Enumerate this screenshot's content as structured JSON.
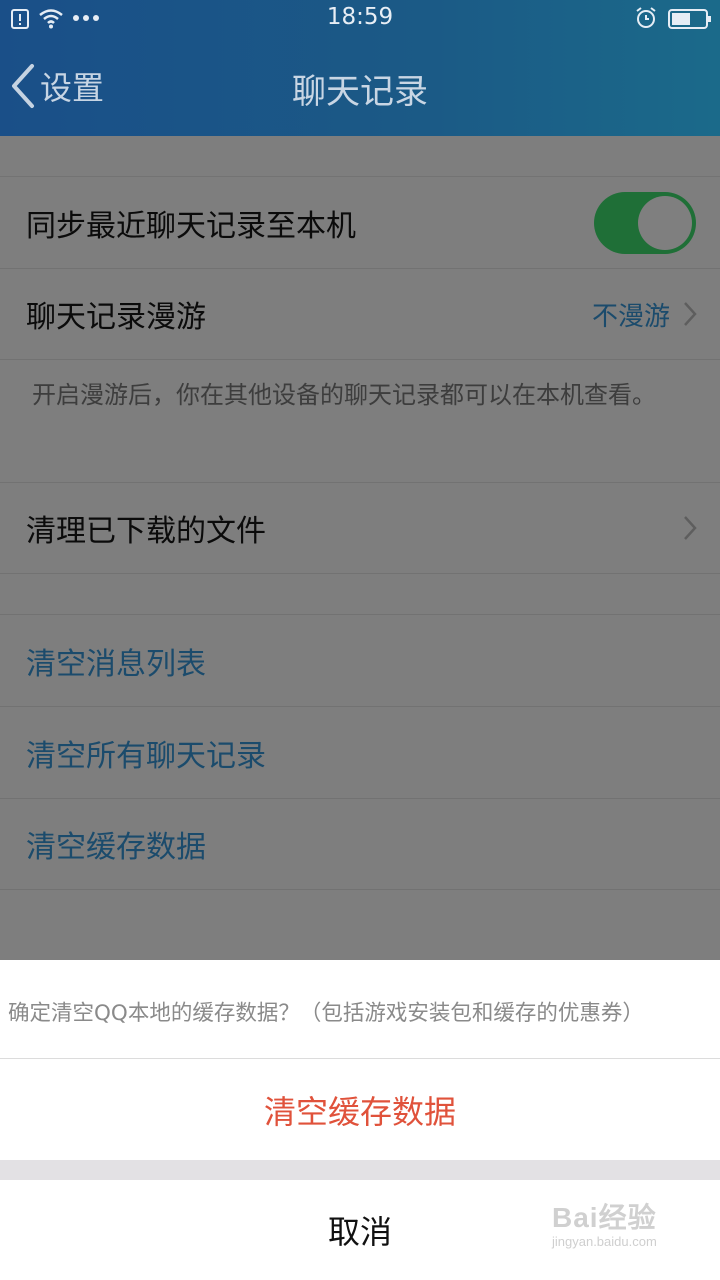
{
  "status_bar": {
    "time": "18:59"
  },
  "nav": {
    "back_label": "设置",
    "title": "聊天记录"
  },
  "settings": {
    "sync": {
      "label": "同步最近聊天记录至本机",
      "enabled": true
    },
    "roaming": {
      "label": "聊天记录漫游",
      "value": "不漫游"
    },
    "roaming_note": "开启漫游后，你在其他设备的聊天记录都可以在本机查看。",
    "clean_downloads": {
      "label": "清理已下载的文件"
    },
    "clear_message_list": "清空消息列表",
    "clear_all_records": "清空所有聊天记录",
    "clear_cache": "清空缓存数据"
  },
  "action_sheet": {
    "message": "确定清空QQ本地的缓存数据？（包括游戏安装包和缓存的优惠券）",
    "confirm": "清空缓存数据",
    "cancel": "取消"
  },
  "watermark": {
    "brand": "Bai经验",
    "url": "jingyan.baidu.com"
  },
  "colors": {
    "header": "#1b5a86",
    "toggle_on": "#1f6f37",
    "link": "#1b4b6c",
    "destructive": "#e0523b"
  }
}
